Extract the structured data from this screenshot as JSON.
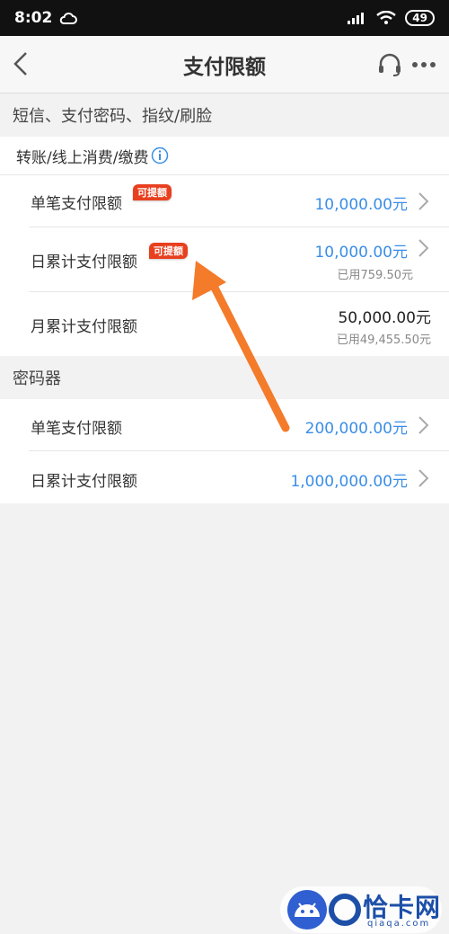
{
  "status": {
    "time": "8:02",
    "battery": "49"
  },
  "nav": {
    "title": "支付限额"
  },
  "section1": {
    "title": "短信、支付密码、指纹/刷脸",
    "subheader": "转账/线上消费/缴费",
    "rows": [
      {
        "label": "单笔支付限额",
        "badge": "可提额",
        "value": "10,000.00元"
      },
      {
        "label": "日累计支付限额",
        "badge": "可提额",
        "value": "10,000.00元",
        "used": "已用759.50元"
      },
      {
        "label": "月累计支付限额",
        "value": "50,000.00元",
        "used": "已用49,455.50元"
      }
    ]
  },
  "section2": {
    "title": "密码器",
    "rows": [
      {
        "label": "单笔支付限额",
        "value": "200,000.00元"
      },
      {
        "label": "日累计支付限额",
        "value": "1,000,000.00元"
      }
    ]
  },
  "watermark": {
    "text": "恰卡网",
    "sub": "qiaqa.com"
  },
  "colors": {
    "accent_blue": "#3a8ee6",
    "badge_red": "#e8401f",
    "arrow_orange": "#f47b2a"
  }
}
